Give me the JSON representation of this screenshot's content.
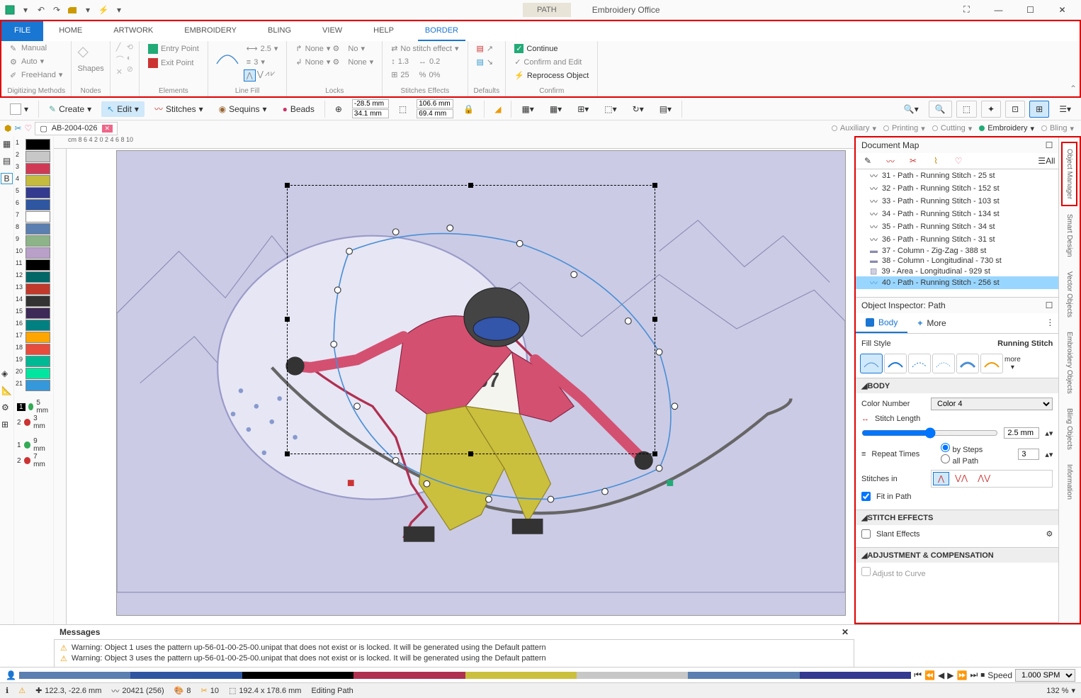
{
  "titlebar": {
    "context": "PATH",
    "title": "Embroidery Office"
  },
  "tabs": {
    "file": "FILE",
    "home": "HOME",
    "artwork": "ARTWORK",
    "embroidery": "EMBROIDERY",
    "bling": "BLING",
    "view": "VIEW",
    "help": "HELP",
    "border": "BORDER"
  },
  "ribbon": {
    "g1": {
      "name": "Digitizing Methods",
      "manual": "Manual",
      "auto": "Auto",
      "freehand": "FreeHand"
    },
    "g2": {
      "name": "Nodes"
    },
    "g3": {
      "name": "Shapes",
      "shapes": "Shapes"
    },
    "g4": {
      "name": "Elements",
      "entry": "Entry Point",
      "exit": "Exit Point"
    },
    "g5": {
      "name": "Line Fill",
      "val1": "2.5",
      "val2": "3"
    },
    "g6": {
      "name": "Locks",
      "none1": "None",
      "none2": "None",
      "no": "No",
      "none3": "None"
    },
    "g7": {
      "name": "Stitches Effects",
      "nse": "No stitch effect",
      "v1": "1.3",
      "v2": "0.2",
      "v3": "25",
      "v4": "0%"
    },
    "g8": {
      "name": "Defaults"
    },
    "g9": {
      "name": "Confirm",
      "cont": "Continue",
      "confirm": "Confirm and Edit",
      "reproc": "Reprocess Object"
    }
  },
  "toolbar": {
    "create": "Create",
    "edit": "Edit",
    "stitches": "Stitches",
    "sequins": "Sequins",
    "beads": "Beads",
    "x1": "-28.5 mm",
    "y1": "34.1 mm",
    "x2": "106.6 mm",
    "y2": "69.4 mm"
  },
  "doc": {
    "name": "AB-2004-026"
  },
  "modes": {
    "aux": "Auxiliary",
    "print": "Printing",
    "cut": "Cutting",
    "emb": "Embroidery",
    "bling": "Bling"
  },
  "colors": [
    "#000000",
    "#c7c7c7",
    "#d13a55",
    "#c5bb3e",
    "#333a8f",
    "#2f56a1",
    "#ffffff",
    "#5a7fb0",
    "#8db388",
    "#b8a0c9",
    "#000000",
    "#006666",
    "#c0392b",
    "#333333",
    "#3d2a56",
    "#008080",
    "#ffa500",
    "#e74c3c",
    "#00b894",
    "#00e5a0",
    "#3498db"
  ],
  "thread1": {
    "size": "5 mm"
  },
  "thread2": {
    "size": "3 mm"
  },
  "thread3": {
    "size": "9 mm"
  },
  "thread4": {
    "size": "7 mm"
  },
  "docmap": {
    "title": "Document Map",
    "all": "All",
    "items": [
      "31 - Path - Running Stitch - 25 st",
      "32 - Path - Running Stitch - 152 st",
      "33 - Path - Running Stitch - 103 st",
      "34 - Path - Running Stitch - 134 st",
      "35 - Path - Running Stitch - 34 st",
      "36 - Path - Running Stitch - 31 st",
      "37 - Column - Zig-Zag - 388 st",
      "38 - Column - Longitudinal - 730 st",
      "39 - Area - Longitudinal - 929 st",
      "40 - Path - Running Stitch - 256 st"
    ]
  },
  "inspector": {
    "title": "Object Inspector: Path",
    "body": "Body",
    "more": "More",
    "fillstyle": "Fill Style",
    "running": "Running Stitch",
    "morebtn": "more",
    "sect_body": "BODY",
    "colornum": "Color Number",
    "colorval": "Color 4",
    "stitchlen": "Stitch Length",
    "stitchval": "2.5 mm",
    "repeat": "Repeat Times",
    "bysteps": "by Steps",
    "allpath": "all Path",
    "repval": "3",
    "stitchesin": "Stitches in",
    "fitinpath": "Fit in Path",
    "sect_eff": "STITCH EFFECTS",
    "slant": "Slant Effects",
    "sect_adj": "ADJUSTMENT & COMPENSATION",
    "adjcurve": "Adjust to Curve"
  },
  "rtabs": {
    "om": "Object Manager",
    "sd": "Smart Design",
    "vo": "Vector Objects",
    "eo": "Embroidery Objects",
    "bo": "Bling Objects",
    "info": "Information"
  },
  "messages": {
    "title": "Messages",
    "m1": "Warning: Object 1 uses the pattern up-56-01-00-25-00.unipat that does not exist or is locked. It will be generated using the Default pattern",
    "m2": "Warning: Object 3 uses the pattern up-56-01-00-25-00.unipat that does not exist or is locked. It will be generated using the Default pattern"
  },
  "playback": {
    "speed": "Speed",
    "spm": "1.000 SPM"
  },
  "status": {
    "pos": "122.3, -22.6 mm",
    "st": "20421 (256)",
    "colors": "8",
    "trims": "10",
    "size": "192.4 x 178.6 mm",
    "mode": "Editing Path",
    "zoom": "132 %"
  },
  "ruler_h": "cm         8          6           4           2           0           2           4           6          8          10"
}
